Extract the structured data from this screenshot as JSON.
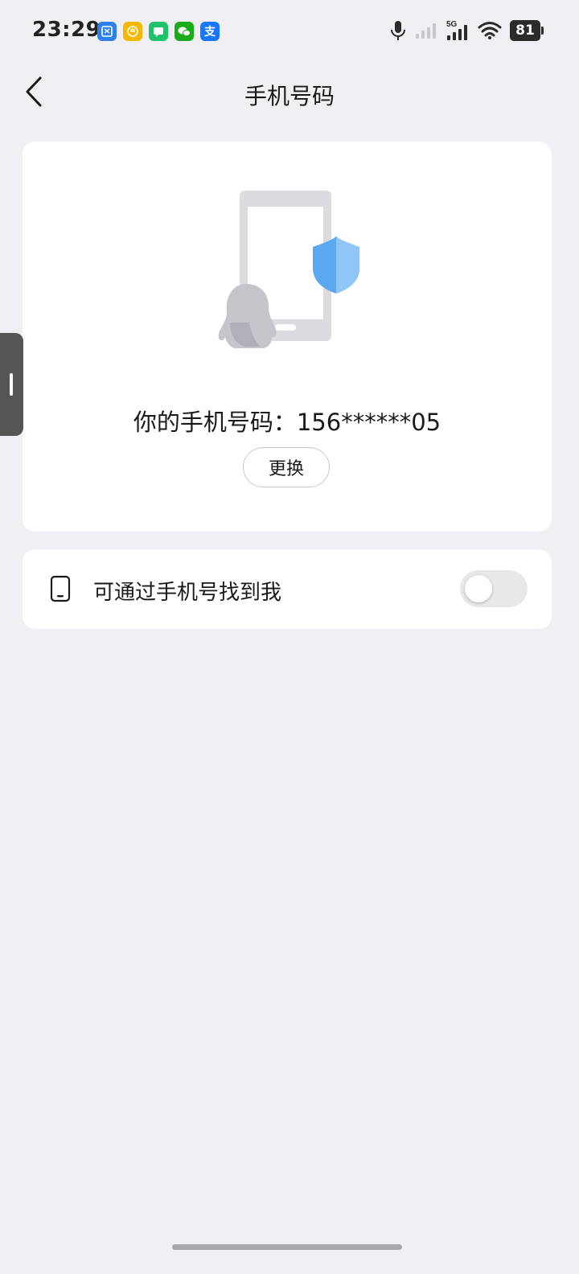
{
  "status_bar": {
    "time": "23:29",
    "network_label": "5G",
    "battery_level": "81",
    "app_icons": [
      {
        "name": "scissors-app-icon",
        "color": "#2f80ed"
      },
      {
        "name": "hand-app-icon",
        "color": "#f5b800"
      },
      {
        "name": "message-app-icon",
        "color": "#1fc26b"
      },
      {
        "name": "wechat-icon",
        "color": "#1aad19"
      },
      {
        "name": "alipay-icon",
        "color": "#1677ff",
        "glyph": "支"
      }
    ]
  },
  "header": {
    "title": "手机号码"
  },
  "phone_card": {
    "phone_text": "你的手机号码：156******05",
    "change_label": "更换"
  },
  "setting": {
    "label": "可通过手机号找到我",
    "toggle_on": false
  },
  "colors": {
    "background": "#efeff4",
    "card": "#ffffff",
    "shield": "#5aa9f0",
    "toggle_off": "#e8e8ea"
  }
}
